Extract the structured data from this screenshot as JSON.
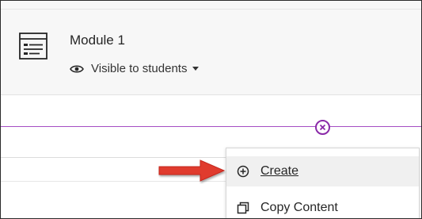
{
  "module": {
    "title": "Module 1",
    "visibility_label": "Visible to students"
  },
  "menu": {
    "items": [
      {
        "label": "Create",
        "icon": "plus-circle-icon"
      },
      {
        "label": "Copy Content",
        "icon": "copy-icon"
      }
    ]
  },
  "colors": {
    "accent_purple": "#8a2aa8",
    "arrow_red": "#e03a2f"
  }
}
